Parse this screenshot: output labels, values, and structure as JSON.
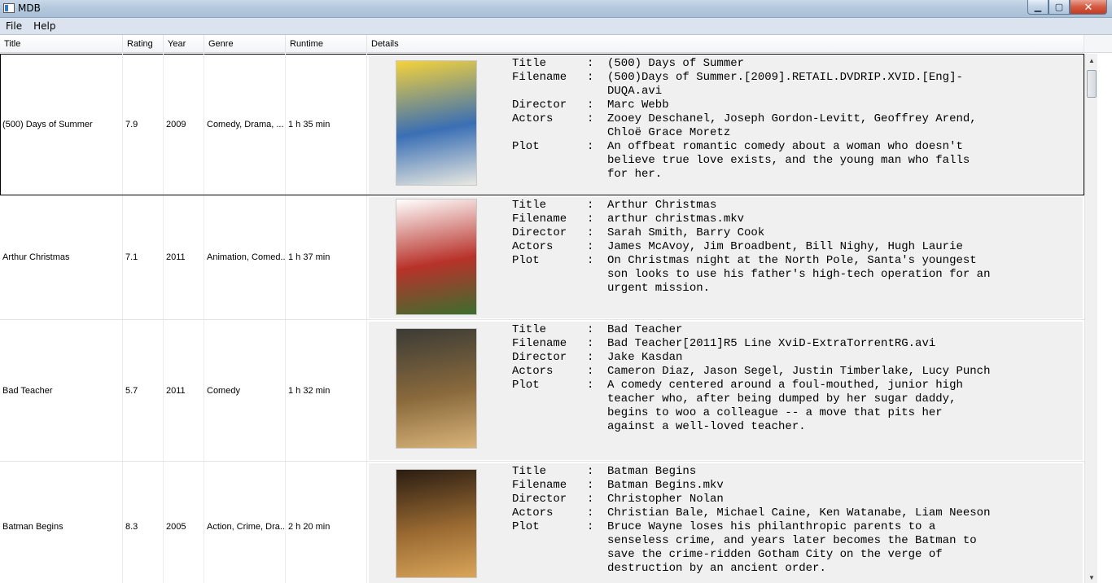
{
  "window": {
    "title": "MDB",
    "minimize_glyph": "▁",
    "maximize_glyph": "▢",
    "close_glyph": "✕"
  },
  "menu": {
    "items": [
      "File",
      "Help"
    ]
  },
  "table": {
    "columns": [
      "Title",
      "Rating",
      "Year",
      "Genre",
      "Runtime",
      "Details"
    ],
    "detail_labels": {
      "title": "Title",
      "filename": "Filename",
      "director": "Director",
      "actors": "Actors",
      "plot": "Plot",
      "sep": ":"
    },
    "rows": [
      {
        "title": "(500) Days of Summer",
        "rating": "7.9",
        "year": "2009",
        "genre": "Comedy, Drama, ...",
        "runtime": "1 h 35 min",
        "details": {
          "title": "(500) Days of Summer",
          "filename": "(500)Days of Summer.[2009].RETAIL.DVDRIP.XVID.[Eng]-DUQA.avi",
          "director": "Marc Webb",
          "actors": "Zooey Deschanel, Joseph Gordon-Levitt, Geoffrey Arend, Chloë Grace Moretz",
          "plot": "An offbeat romantic comedy about a woman who doesn't believe true love exists, and the young man who falls for her."
        },
        "poster_colors": [
          "#f4d23a",
          "#3a6fb5",
          "#e8e8e0"
        ]
      },
      {
        "title": "Arthur Christmas",
        "rating": "7.1",
        "year": "2011",
        "genre": "Animation, Comed...",
        "runtime": "1 h 37 min",
        "details": {
          "title": "Arthur Christmas",
          "filename": "arthur christmas.mkv",
          "director": "Sarah Smith, Barry Cook",
          "actors": "James McAvoy, Jim Broadbent, Bill Nighy, Hugh Laurie",
          "plot": "On Christmas night at the North Pole, Santa's youngest son looks to use his father's high-tech operation for an urgent mission."
        },
        "poster_colors": [
          "#ffffff",
          "#b8322a",
          "#3c6e2f"
        ]
      },
      {
        "title": "Bad Teacher",
        "rating": "5.7",
        "year": "2011",
        "genre": "Comedy",
        "runtime": "1 h 32 min",
        "details": {
          "title": "Bad Teacher",
          "filename": "Bad Teacher[2011]R5 Line XviD-ExtraTorrentRG.avi",
          "director": "Jake Kasdan",
          "actors": "Cameron Diaz, Jason Segel, Justin Timberlake, Lucy Punch",
          "plot": "A comedy centered around a foul-mouthed, junior high teacher who, after being dumped by her sugar daddy, begins to woo a colleague -- a move that pits her against a well-loved teacher."
        },
        "poster_colors": [
          "#3b3b36",
          "#8a6a3c",
          "#d9b47a"
        ]
      },
      {
        "title": "Batman Begins",
        "rating": "8.3",
        "year": "2005",
        "genre": "Action, Crime, Dra...",
        "runtime": "2 h 20 min",
        "details": {
          "title": "Batman Begins",
          "filename": "Batman Begins.mkv",
          "director": "Christopher Nolan",
          "actors": "Christian Bale, Michael Caine, Ken Watanabe, Liam Neeson",
          "plot": "Bruce Wayne loses his philanthropic parents to a senseless crime, and years later becomes the Batman to save the crime-ridden Gotham City on the verge of destruction by an ancient order."
        },
        "poster_colors": [
          "#2a1d12",
          "#9a6a32",
          "#d9a55a"
        ]
      }
    ]
  }
}
